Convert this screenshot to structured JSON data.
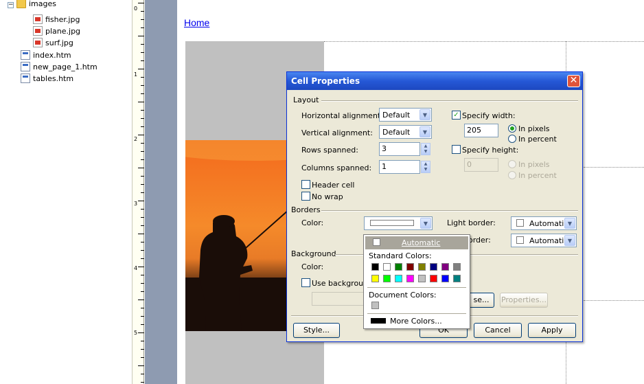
{
  "folder_tree": {
    "items": [
      {
        "label": "images",
        "type": "folder"
      },
      {
        "label": "fisher.jpg",
        "type": "image"
      },
      {
        "label": "plane.jpg",
        "type": "image"
      },
      {
        "label": "surf.jpg",
        "type": "image"
      },
      {
        "label": "index.htm",
        "type": "home-page"
      },
      {
        "label": "new_page_1.htm",
        "type": "page"
      },
      {
        "label": "tables.htm",
        "type": "page"
      }
    ]
  },
  "ruler": {
    "numbers": [
      "0",
      "1",
      "2",
      "3",
      "4",
      "5"
    ]
  },
  "page": {
    "home_link": "Home"
  },
  "dialog": {
    "title": "Cell Properties",
    "close": "✕",
    "layout": {
      "heading": "Layout",
      "horizontal_alignment_label": "Horizontal alignment:",
      "horizontal_alignment_value": "Default",
      "vertical_alignment_label": "Vertical alignment:",
      "vertical_alignment_value": "Default",
      "rows_spanned_label": "Rows spanned:",
      "rows_spanned_value": "3",
      "columns_spanned_label": "Columns spanned:",
      "columns_spanned_value": "1",
      "header_cell_label": "Header cell",
      "header_cell_checked": false,
      "no_wrap_label": "No wrap",
      "no_wrap_checked": false,
      "specify_width_label": "Specify width:",
      "specify_width_checked": true,
      "width_value": "205",
      "width_in_pixels_label": "In pixels",
      "width_in_percent_label": "In percent",
      "width_unit_selected": "In pixels",
      "specify_height_label": "Specify height:",
      "specify_height_checked": false,
      "height_value": "0",
      "height_in_pixels_label": "In pixels",
      "height_in_percent_label": "In percent"
    },
    "borders": {
      "heading": "Borders",
      "color_label": "Color:",
      "light_border_label": "Light border:",
      "light_border_value": "Automatic",
      "dark_border_label_visible": "order:",
      "dark_border_value": "Automatic"
    },
    "background": {
      "heading": "Background",
      "color_label": "Color:",
      "use_background_label": "Use background",
      "browse_label": "se...",
      "properties_label": "Properties..."
    },
    "buttons": {
      "style": "Style...",
      "ok": "OK",
      "cancel": "Cancel",
      "apply": "Apply"
    }
  },
  "color_popup": {
    "automatic_label": "Automatic",
    "standard_colors_label": "Standard Colors:",
    "standard_colors": [
      "#000000",
      "#ffffff",
      "#008000",
      "#800000",
      "#808000",
      "#000080",
      "#800080",
      "#808080",
      "#ffff00",
      "#00ff00",
      "#00ffff",
      "#ff00ff",
      "#c0c0c0",
      "#ff0000",
      "#0000ff",
      "#008080"
    ],
    "document_colors_label": "Document Colors:",
    "document_colors": [
      "#c0c0c0"
    ],
    "more_colors_label": "More Colors..."
  },
  "colors": {
    "title_bar": "#2558d6",
    "dialog_face": "#ece9d8",
    "link": "#0000ee"
  }
}
